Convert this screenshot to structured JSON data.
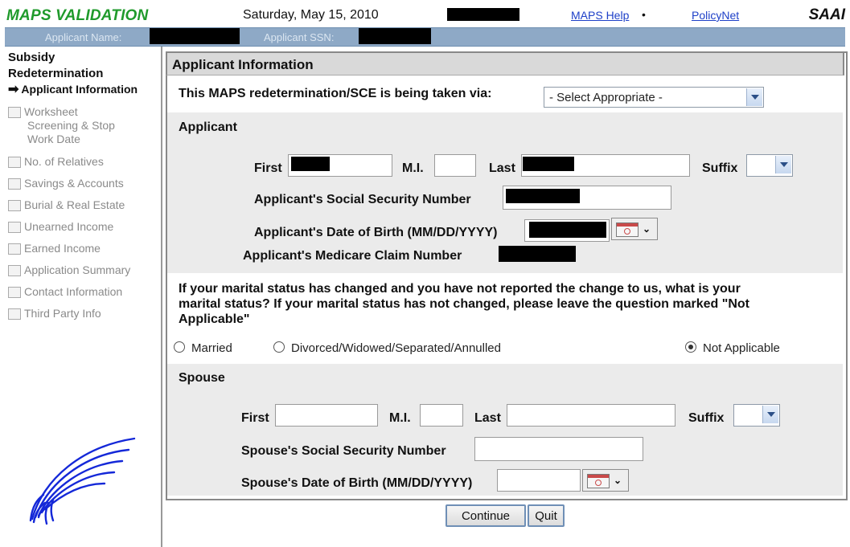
{
  "header": {
    "app_title": "MAPS VALIDATION",
    "date": "Saturday, May 15, 2010",
    "help_link": "MAPS Help",
    "help_bullet": "•",
    "policy_link": "PolicyNet",
    "agency": "SAAI"
  },
  "applicant_bar": {
    "name_label": "Applicant Name:",
    "ssn_label": "Applicant SSN:"
  },
  "sidebar": {
    "heading_line1": "Subsidy",
    "heading_line2": "Redetermination",
    "items": [
      {
        "label": "Applicant Information",
        "active": true
      },
      {
        "label": "Worksheet",
        "sub1": "Screening  & Stop",
        "sub2": "Work  Date"
      },
      {
        "label": "No. of Relatives"
      },
      {
        "label": "Savings & Accounts"
      },
      {
        "label": "Burial & Real Estate"
      },
      {
        "label": "Unearned Income"
      },
      {
        "label": "Earned Income"
      },
      {
        "label": "Application Summary"
      },
      {
        "label": "Contact Information"
      },
      {
        "label": "Third Party Info"
      }
    ],
    "logo_icon": "eagle-logo-icon"
  },
  "main": {
    "panel_title": "Applicant Information",
    "via_question": "This MAPS redetermination/SCE is being taken via:",
    "via_select": "- Select Appropriate -",
    "applicant_section": "Applicant",
    "first_label": "First",
    "mi_label": "M.I.",
    "last_label": "Last",
    "suffix_label": "Suffix",
    "ssn_label": "Applicant's Social Security Number",
    "dob_label": "Applicant's Date of Birth (MM/DD/YYYY)",
    "medicare_label": "Applicant's Medicare Claim Number",
    "marital_question_line1": "If your marital status has changed and you have not reported the change to us, what is your",
    "marital_question_line2": "marital status? If your marital status has not changed, please leave the question marked \"Not",
    "marital_question_line3": "Applicable\"",
    "marital_options": [
      "Married",
      "Divorced/Widowed/Separated/Annulled",
      "Not Applicable"
    ],
    "marital_selected": "Not Applicable",
    "spouse_section": "Spouse",
    "spouse_ssn_label": "Spouse's Social Security Number",
    "spouse_dob_label": "Spouse's Date of Birth (MM/DD/YYYY)"
  },
  "buttons": {
    "continue": "Continue",
    "quit": "Quit"
  },
  "colors": {
    "title_green": "#1f9a2b",
    "link_blue": "#1e40c8",
    "applicant_bar": "#8ea9c6",
    "section_gray": "#ebebeb"
  }
}
